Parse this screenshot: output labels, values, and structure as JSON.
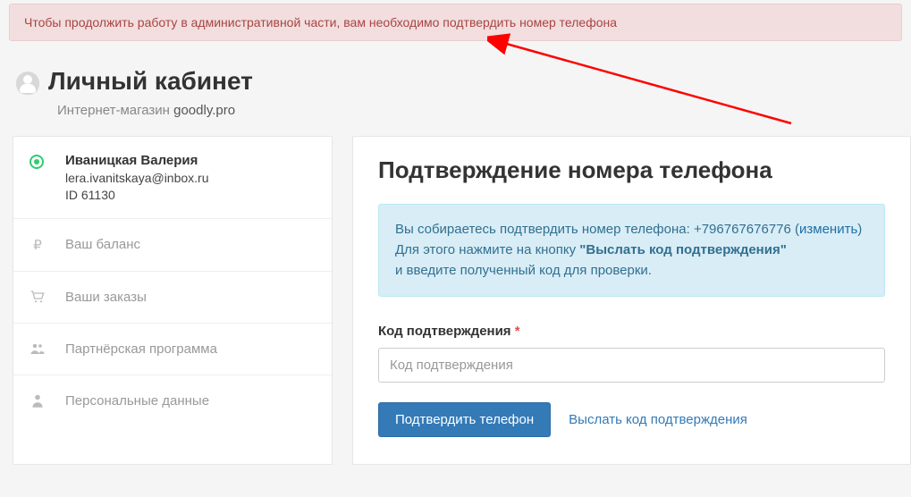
{
  "alert": {
    "text": "Чтобы продолжить работу в административной части, вам необходимо подтвердить номер телефона"
  },
  "header": {
    "title": "Личный кабинет",
    "sub_prefix": "Интернет-магазин ",
    "shop_name": "goodly.pro"
  },
  "sidebar": {
    "user": {
      "name": "Иваницкая Валерия",
      "email": "lera.ivanitskaya@inbox.ru",
      "id_label": "ID 61130"
    },
    "items": {
      "balance": "Ваш баланс",
      "orders": "Ваши заказы",
      "affiliate": "Партнёрская программа",
      "personal": "Персональные данные"
    }
  },
  "main": {
    "title": "Подтверждение номера телефона",
    "info": {
      "line1_prefix": "Вы собираетесь подтвердить номер телефона: ",
      "phone": "+796767676776",
      "change_open": " (",
      "change_label": "изменить",
      "change_close": ")",
      "line2_prefix": "Для этого нажмите на кнопку ",
      "line2_bold": "\"Выслать код подтверждения\"",
      "line3": "и введите полученный код для проверки."
    },
    "form": {
      "label": "Код подтверждения",
      "required_mark": "*",
      "placeholder": "Код подтверждения",
      "submit_label": "Подтвердить телефон",
      "resend_label": "Выслать код подтверждения"
    }
  },
  "colors": {
    "alert_bg": "#f2dede",
    "alert_text": "#a94442",
    "info_bg": "#d9edf7",
    "info_text": "#31708f",
    "primary": "#337ab7",
    "arrow": "#ff0000"
  }
}
